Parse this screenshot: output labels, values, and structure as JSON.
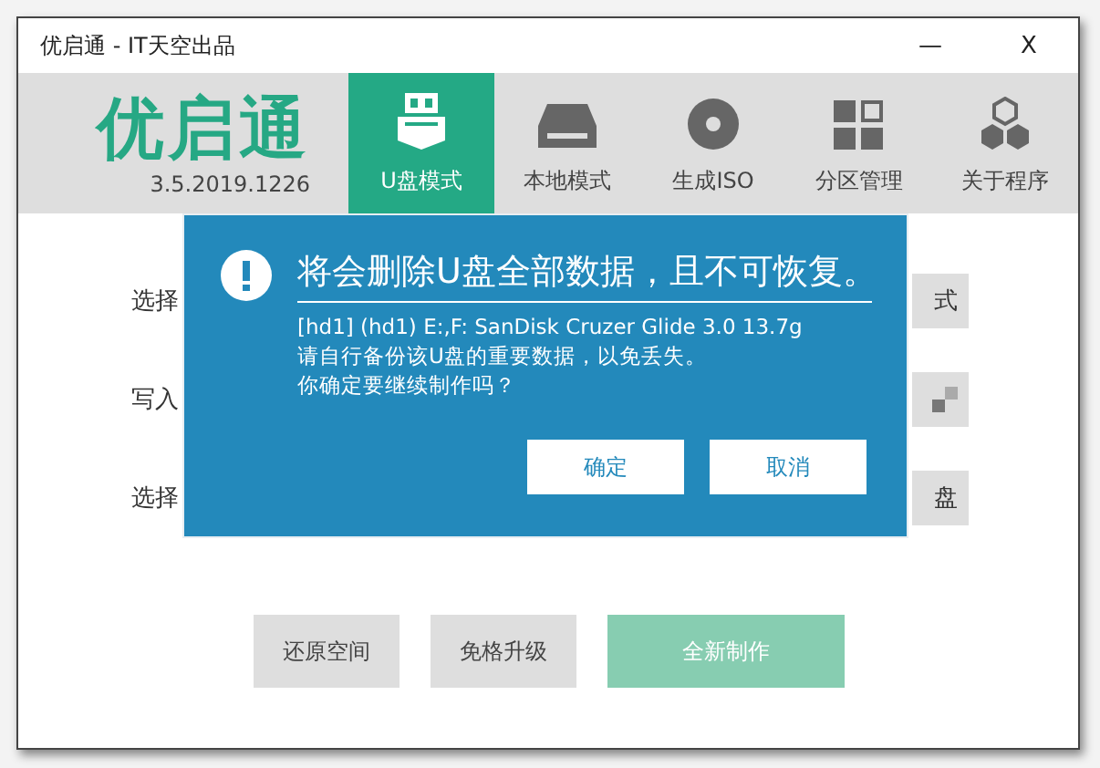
{
  "window": {
    "title": "优启通 - IT天空出品",
    "controls": [
      "—",
      "X"
    ]
  },
  "logo": {
    "name": "优启通",
    "version": "3.5.2019.1226"
  },
  "tabs": [
    {
      "label": "U盘模式",
      "kind": "usb",
      "selected": true
    },
    {
      "label": "本地模式",
      "kind": "drive",
      "selected": false
    },
    {
      "label": "生成ISO",
      "kind": "disc",
      "selected": false
    },
    {
      "label": "分区管理",
      "kind": "grid",
      "selected": false
    },
    {
      "label": "关于程序",
      "kind": "hexagons",
      "selected": false
    }
  ],
  "form": {
    "rows": [
      {
        "label": "选择",
        "kind": "text",
        "button": "式"
      },
      {
        "label": "写入",
        "kind": "icon"
      },
      {
        "label": "选择",
        "kind": "text",
        "button": "盘"
      }
    ]
  },
  "actions": [
    {
      "label": "还原空间",
      "primary": false,
      "disabled": false
    },
    {
      "label": "免格升级",
      "primary": false,
      "disabled": false
    },
    {
      "label": "全新制作",
      "primary": true,
      "disabled": true
    }
  ],
  "dialog": {
    "title": "将会删除U盘全部数据，且不可恢复。",
    "lines": [
      "[hd1] (hd1) E:,F: SanDisk Cruzer Glide 3.0 13.7g",
      "请自行备份该U盘的重要数据，以免丢失。",
      "你确定要继续制作吗？"
    ],
    "buttons": [
      "确定",
      "取消"
    ]
  }
}
